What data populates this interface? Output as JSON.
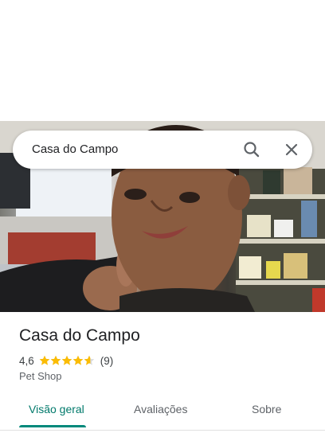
{
  "search": {
    "query": "Casa do Campo"
  },
  "icons": {
    "search": "search-icon",
    "close": "close-icon",
    "star": "star-icon"
  },
  "place": {
    "name": "Casa do Campo",
    "rating": "4,6",
    "rating_value": 4.6,
    "review_count": "(9)",
    "category": "Pet Shop"
  },
  "tabs": [
    {
      "label": "Visão geral",
      "active": true
    },
    {
      "label": "Avaliações",
      "active": false
    },
    {
      "label": "Sobre",
      "active": false
    }
  ],
  "colors": {
    "accent": "#00796b",
    "star": "#fbbc04",
    "text": "#202124",
    "muted": "#5f6368"
  }
}
